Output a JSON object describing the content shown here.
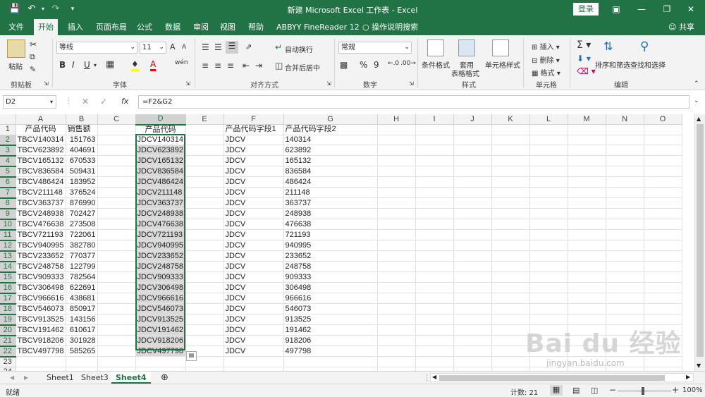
{
  "app": {
    "title": "新建 Microsoft Excel 工作表 - Excel",
    "login": "登录",
    "accent": "#217346"
  },
  "tabs": [
    "文件",
    "开始",
    "插入",
    "页面布局",
    "公式",
    "数据",
    "审阅",
    "视图",
    "帮助",
    "ABBYY FineReader 12",
    "操作说明搜索",
    "共享"
  ],
  "ribbon": {
    "clipboard": {
      "paste": "粘贴",
      "label": "剪贴板"
    },
    "font": {
      "name": "等线",
      "size": "11",
      "bold": "B",
      "italic": "I",
      "underline": "U",
      "label": "字体",
      "grow": "A",
      "shrink": "A",
      "wen": "wén"
    },
    "alignment": {
      "wrap": "自动换行",
      "merge": "合并后居中",
      "label": "对齐方式"
    },
    "number": {
      "format": "常规",
      "percent": "%",
      "comma": "9",
      "label": "数字"
    },
    "styles": {
      "conditional": "条件格式",
      "table1": "套用",
      "table2": "表格格式",
      "cell": "单元格样式",
      "label": "样式"
    },
    "cells": {
      "insert": "插入",
      "delete": "删除",
      "format": "格式",
      "label": "单元格"
    },
    "editing": {
      "sort": "排序和筛选",
      "find": "查找和选择",
      "label": "编辑"
    }
  },
  "formula_bar": {
    "name_box": "D2",
    "formula": "=F2&G2",
    "fx": "fx"
  },
  "columns": [
    "A",
    "B",
    "C",
    "D",
    "E",
    "F",
    "G",
    "H",
    "I",
    "J",
    "K",
    "L",
    "M",
    "N",
    "O"
  ],
  "rows": [
    [
      "产品代码",
      "销售额",
      "",
      "产品代码",
      "",
      "产品代码字段1",
      "产品代码字段2"
    ],
    [
      "TBCV140314",
      "151763",
      "",
      "JDCV140314",
      "",
      "JDCV",
      "140314"
    ],
    [
      "TBCV623892",
      "404691",
      "",
      "JDCV623892",
      "",
      "JDCV",
      "623892"
    ],
    [
      "TBCV165132",
      "670533",
      "",
      "JDCV165132",
      "",
      "JDCV",
      "165132"
    ],
    [
      "TBCV836584",
      "509431",
      "",
      "JDCV836584",
      "",
      "JDCV",
      "836584"
    ],
    [
      "TBCV486424",
      "183952",
      "",
      "JDCV486424",
      "",
      "JDCV",
      "486424"
    ],
    [
      "TBCV211148",
      "376524",
      "",
      "JDCV211148",
      "",
      "JDCV",
      "211148"
    ],
    [
      "TBCV363737",
      "876990",
      "",
      "JDCV363737",
      "",
      "JDCV",
      "363737"
    ],
    [
      "TBCV248938",
      "702427",
      "",
      "JDCV248938",
      "",
      "JDCV",
      "248938"
    ],
    [
      "TBCV476638",
      "273508",
      "",
      "JDCV476638",
      "",
      "JDCV",
      "476638"
    ],
    [
      "TBCV721193",
      "722061",
      "",
      "JDCV721193",
      "",
      "JDCV",
      "721193"
    ],
    [
      "TBCV940995",
      "382780",
      "",
      "JDCV940995",
      "",
      "JDCV",
      "940995"
    ],
    [
      "TBCV233652",
      "770377",
      "",
      "JDCV233652",
      "",
      "JDCV",
      "233652"
    ],
    [
      "TBCV248758",
      "122799",
      "",
      "JDCV248758",
      "",
      "JDCV",
      "248758"
    ],
    [
      "TBCV909333",
      "782564",
      "",
      "JDCV909333",
      "",
      "JDCV",
      "909333"
    ],
    [
      "TBCV306498",
      "622691",
      "",
      "JDCV306498",
      "",
      "JDCV",
      "306498"
    ],
    [
      "TBCV966616",
      "438681",
      "",
      "JDCV966616",
      "",
      "JDCV",
      "966616"
    ],
    [
      "TBCV546073",
      "850917",
      "",
      "JDCV546073",
      "",
      "JDCV",
      "546073"
    ],
    [
      "TBCV913525",
      "143156",
      "",
      "JDCV913525",
      "",
      "JDCV",
      "913525"
    ],
    [
      "TBCV191462",
      "610617",
      "",
      "JDCV191462",
      "",
      "JDCV",
      "191462"
    ],
    [
      "TBCV918206",
      "301928",
      "",
      "JDCV918206",
      "",
      "JDCV",
      "918206"
    ],
    [
      "TBCV497798",
      "585265",
      "",
      "JDCV497798",
      "",
      "JDCV",
      "497798"
    ],
    [
      "",
      "",
      "",
      "",
      "",
      "",
      ""
    ],
    [
      "",
      "",
      "",
      "",
      "",
      "",
      ""
    ]
  ],
  "sheets": [
    "Sheet1",
    "Sheet3",
    "Sheet4"
  ],
  "active_sheet": "Sheet4",
  "status": {
    "ready": "就绪",
    "count": "计数: 21",
    "zoom": "100%"
  },
  "watermark": {
    "text": "Bai du 经验",
    "url": "jingyan.baidu.com"
  }
}
